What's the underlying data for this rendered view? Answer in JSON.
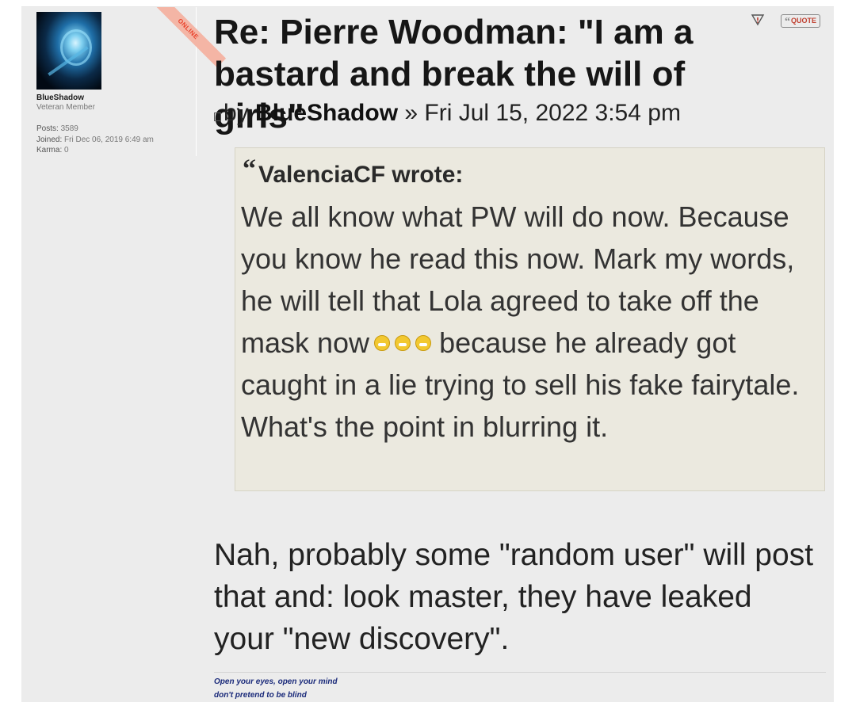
{
  "profile": {
    "online_badge": "ONLINE",
    "username": "BlueShadow",
    "rank": "Veteran Member",
    "posts_label": "Posts:",
    "posts_value": "3589",
    "joined_label": "Joined:",
    "joined_value": "Fri Dec 06, 2019 6:49 am",
    "karma_label": "Karma:",
    "karma_value": "0"
  },
  "post": {
    "title": "Re: Pierre Woodman: \"I am a bastard and break the will of girls\"",
    "by_prefix": "by",
    "author": "BlueShadow",
    "separator": "»",
    "date": "Fri Jul 15, 2022 3:54 pm",
    "quote_button_label": "QUOTE",
    "quote": {
      "cite": "ValenciaCF wrote:",
      "text_before_emoji": "We all know what PW will do now. Because you know he read this now. Mark my words, he will tell that Lola agreed to take off the mask now",
      "emoji": "grin-emoji",
      "text_after_emoji": "because he already got caught in a lie trying to sell his fake fairytale. What's the point in blurring it."
    },
    "reply_text": "Nah, probably some \"random user\" will post that and: look master, they have leaked your \"new discovery\".",
    "signature": [
      "Open your eyes, open your mind",
      "don't pretend to be blind"
    ]
  },
  "colors": {
    "post_bg": "#ececec",
    "quote_bg": "#ebe9df",
    "online_ribbon": "#f4b5a5",
    "signature": "#1a2a7a"
  }
}
